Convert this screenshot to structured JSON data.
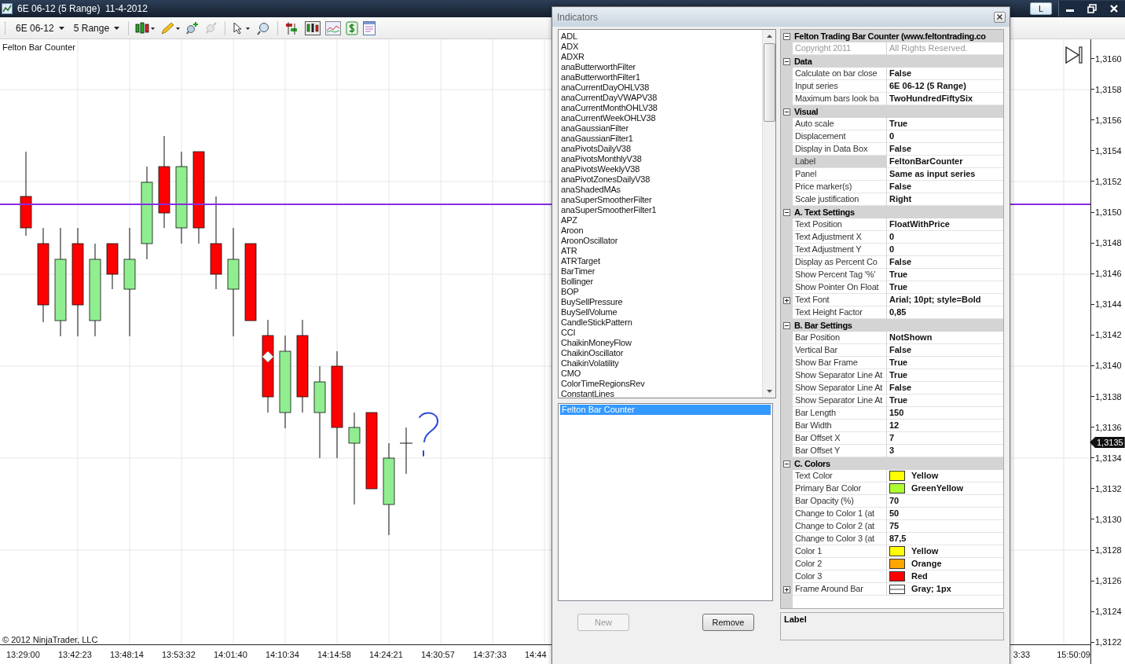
{
  "window": {
    "title": "6E 06-12 (5 Range)  11-4-2012",
    "link_button": "L"
  },
  "toolbar": {
    "dropdowns": [
      "6E 06-12",
      "5 Range"
    ]
  },
  "chart": {
    "title": "Felton Bar Counter",
    "copyright": "© 2012 NinjaTrader, LLC"
  },
  "price_axis": {
    "labels": [
      "1,3160",
      "1,3158",
      "1,3156",
      "1,3154",
      "1,3152",
      "1,3150",
      "1,3148",
      "1,3146",
      "1,3144",
      "1,3142",
      "1,3140",
      "1,3138",
      "1,3136",
      "1,3134",
      "1,3132",
      "1,3130",
      "1,3128",
      "1,3126",
      "1,3124",
      "1,3122"
    ],
    "current_price": "1,3135"
  },
  "time_axis": {
    "labels": [
      "13:29:00",
      "13:42:23",
      "13:48:14",
      "13:53:32",
      "14:01:40",
      "14:10:34",
      "14:14:58",
      "14:24:21",
      "14:30:57",
      "14:37:33",
      "14:44"
    ],
    "trailing_labels": [
      "3:33",
      "15:50:09"
    ]
  },
  "indicators_dialog": {
    "title": "Indicators",
    "available": [
      "ADL",
      "ADX",
      "ADXR",
      "anaButterworthFilter",
      "anaButterworthFilter1",
      "anaCurrentDayOHLV38",
      "anaCurrentDayVWAPV38",
      "anaCurrentMonthOHLV38",
      "anaCurrentWeekOHLV38",
      "anaGaussianFilter",
      "anaGaussianFilter1",
      "anaPivotsDailyV38",
      "anaPivotsMonthlyV38",
      "anaPivotsWeeklyV38",
      "anaPivotZonesDailyV38",
      "anaShadedMAs",
      "anaSuperSmootherFilter",
      "anaSuperSmootherFilter1",
      "APZ",
      "Aroon",
      "AroonOscillator",
      "ATR",
      "ATRTarget",
      "BarTimer",
      "Bollinger",
      "BOP",
      "BuySellPressure",
      "BuySellVolume",
      "CandleStickPattern",
      "CCI",
      "ChaikinMoneyFlow",
      "ChaikinOscillator",
      "ChaikinVolatility",
      "CMO",
      "ColorTimeRegionsRev",
      "ConstantLines"
    ],
    "applied": [
      {
        "label": "Felton Bar Counter",
        "selected": true
      }
    ],
    "buttons": [
      {
        "label": "New",
        "disabled": true
      },
      {
        "label": "Remove",
        "disabled": false
      }
    ],
    "properties": [
      {
        "title": "Felton Trading Bar Counter (www.feltontrading.co",
        "expanded": true,
        "rows": [
          {
            "label": "Copyright 2011",
            "value": "All Rights Reserved.",
            "kind": "readonly",
            "selected": false
          }
        ]
      },
      {
        "title": "Data",
        "expanded": true,
        "rows": [
          {
            "label": "Calculate on bar close",
            "value": "False",
            "kind": "text",
            "selected": false
          },
          {
            "label": "Input series",
            "value": "6E 06-12 (5 Range)",
            "kind": "text",
            "selected": false
          },
          {
            "label": "Maximum bars look ba",
            "value": "TwoHundredFiftySix",
            "kind": "text",
            "selected": false
          }
        ]
      },
      {
        "title": "Visual",
        "expanded": true,
        "rows": [
          {
            "label": "Auto scale",
            "value": "True",
            "kind": "text",
            "selected": false
          },
          {
            "label": "Displacement",
            "value": "0",
            "kind": "text",
            "selected": false
          },
          {
            "label": "Display in Data Box",
            "value": "False",
            "kind": "text",
            "selected": false
          },
          {
            "label": "Label",
            "value": "FeltonBarCounter",
            "kind": "text",
            "selected": true
          },
          {
            "label": "Panel",
            "value": "Same as input series",
            "kind": "text",
            "selected": false
          },
          {
            "label": "Price marker(s)",
            "value": "False",
            "kind": "text",
            "selected": false
          },
          {
            "label": "Scale justification",
            "value": "Right",
            "kind": "text",
            "selected": false
          }
        ]
      },
      {
        "title": "A. Text Settings",
        "expanded": true,
        "rows": [
          {
            "label": "Text Position",
            "value": "FloatWithPrice",
            "kind": "text",
            "selected": false
          },
          {
            "label": "Text Adjustment X",
            "value": "0",
            "kind": "text",
            "selected": false
          },
          {
            "label": "Text Adjustment Y",
            "value": "0",
            "kind": "text",
            "selected": false
          },
          {
            "label": "Display as Percent Co",
            "value": "False",
            "kind": "text",
            "selected": false
          },
          {
            "label": "Show Percent Tag '%'",
            "value": "True",
            "kind": "text",
            "selected": false
          },
          {
            "label": "Show Pointer On Float",
            "value": "True",
            "kind": "text",
            "selected": false
          },
          {
            "label": "Text Font",
            "value": "Arial; 10pt; style=Bold",
            "kind": "group",
            "expanded": false,
            "selected": false
          },
          {
            "label": "Text Height Factor",
            "value": "0,85",
            "kind": "text",
            "selected": false
          }
        ]
      },
      {
        "title": "B. Bar Settings",
        "expanded": true,
        "rows": [
          {
            "label": "Bar Position",
            "value": "NotShown",
            "kind": "text",
            "selected": false
          },
          {
            "label": "Vertical Bar",
            "value": "False",
            "kind": "text",
            "selected": false
          },
          {
            "label": "Show Bar Frame",
            "value": "True",
            "kind": "text",
            "selected": false
          },
          {
            "label": "Show Separator Line At",
            "value": "True",
            "kind": "text",
            "selected": false
          },
          {
            "label": "Show Separator Line At",
            "value": "False",
            "kind": "text",
            "selected": false
          },
          {
            "label": "Show Separator Line At",
            "value": "True",
            "kind": "text",
            "selected": false
          },
          {
            "label": "Bar Length",
            "value": "150",
            "kind": "text",
            "selected": false
          },
          {
            "label": "Bar Width",
            "value": "12",
            "kind": "text",
            "selected": false
          },
          {
            "label": "Bar Offset X",
            "value": "7",
            "kind": "text",
            "selected": false
          },
          {
            "label": "Bar Offset Y",
            "value": "3",
            "kind": "text",
            "selected": false
          }
        ]
      },
      {
        "title": "C. Colors",
        "expanded": true,
        "rows": [
          {
            "label": "Text Color",
            "value": "Yellow",
            "kind": "color",
            "color": "#ffff00",
            "selected": false
          },
          {
            "label": "Primary Bar Color",
            "value": "GreenYellow",
            "kind": "color",
            "color": "#adff2f",
            "selected": false
          },
          {
            "label": "Bar Opacity (%)",
            "value": "70",
            "kind": "text",
            "selected": false
          },
          {
            "label": "Change to Color 1 (at",
            "value": "50",
            "kind": "text",
            "selected": false
          },
          {
            "label": "Change to Color 2 (at",
            "value": "75",
            "kind": "text",
            "selected": false
          },
          {
            "label": "Change to Color 3 (at",
            "value": "87,5",
            "kind": "text",
            "selected": false
          },
          {
            "label": "Color 1",
            "value": "Yellow",
            "kind": "color",
            "color": "#ffff00",
            "selected": false
          },
          {
            "label": "Color 2",
            "value": "Orange",
            "kind": "color",
            "color": "#ffa500",
            "selected": false
          },
          {
            "label": "Color 3",
            "value": "Red",
            "kind": "color",
            "color": "#ff0000",
            "selected": false
          },
          {
            "label": "Frame Around Bar",
            "value": "Gray; 1px",
            "kind": "frame",
            "expanded": false,
            "selected": false
          }
        ]
      }
    ],
    "description": {
      "title": "Label"
    }
  }
}
